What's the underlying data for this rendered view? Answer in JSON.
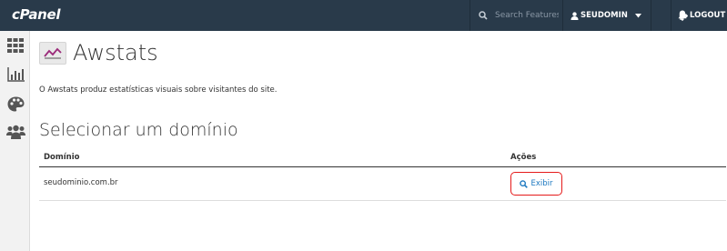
{
  "header": {
    "logo_text": "cPanel",
    "search_placeholder": "Search Features",
    "username": "SEUDOMIN",
    "logout_label": "LOGOUT",
    "bar_color": "#293a4a"
  },
  "sidebar": {
    "items": [
      {
        "icon": "grid-icon"
      },
      {
        "icon": "bar-chart-icon"
      },
      {
        "icon": "palette-icon"
      },
      {
        "icon": "users-icon"
      }
    ]
  },
  "main": {
    "page_title": "Awstats",
    "description": "O Awstats produz estatísticas visuais sobre visitantes do site.",
    "section_title": "Selecionar um domínio",
    "table": {
      "columns": [
        "Domínio",
        "Ações"
      ],
      "rows": [
        {
          "domain": "seudominio.com.br",
          "action_label": "Exibir"
        }
      ]
    },
    "link_color": "#1c78c0",
    "highlight_color": "#e51a1a"
  }
}
